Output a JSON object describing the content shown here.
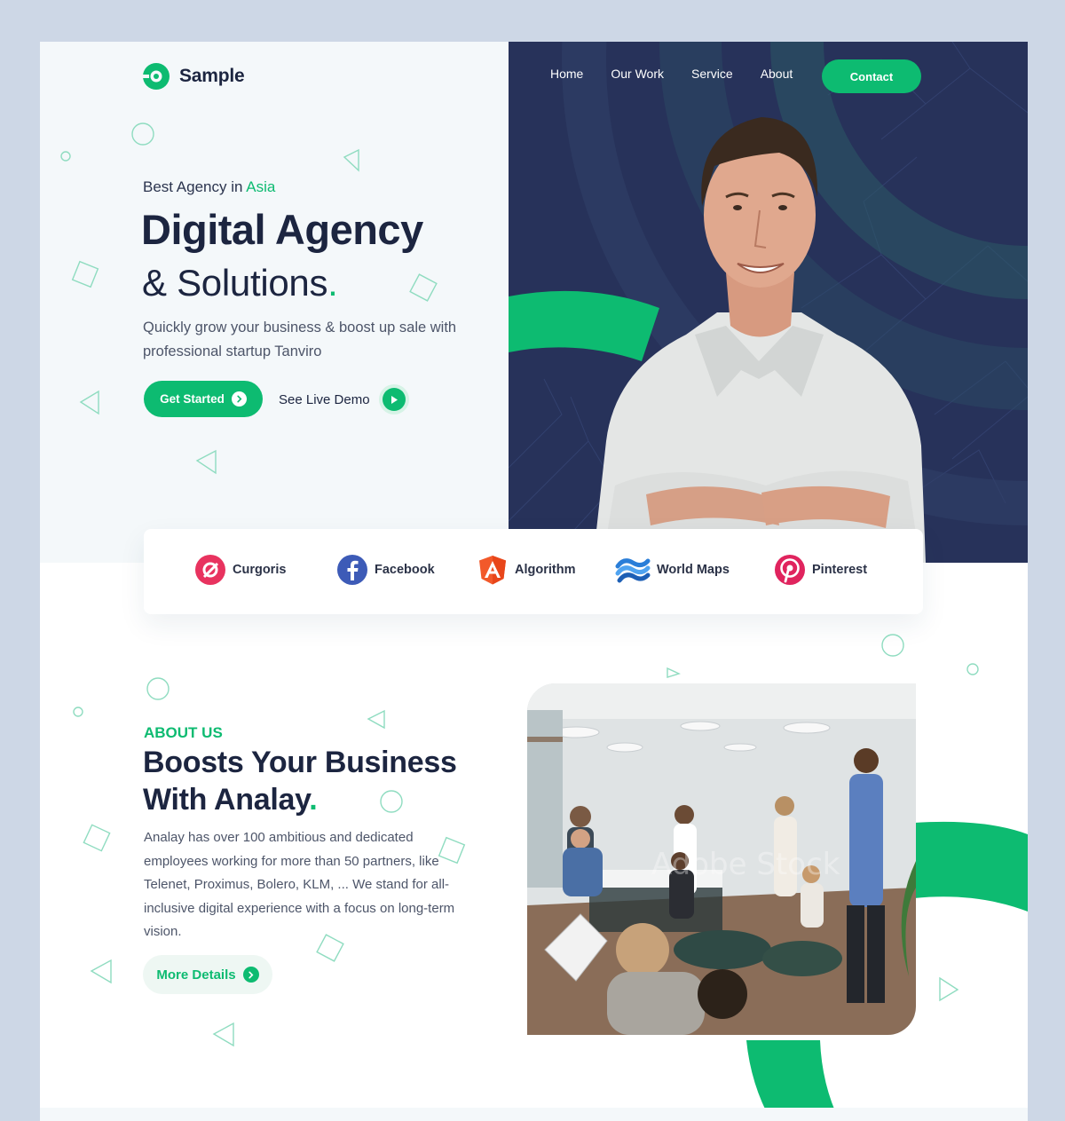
{
  "brand": {
    "name": "Sample",
    "accent_color": "#0dbb71",
    "dark_color": "#1c2540",
    "hero_panel_color": "#27325a"
  },
  "nav": {
    "links": [
      "Home",
      "Our Work",
      "Service",
      "About"
    ],
    "contact_label": "Contact"
  },
  "hero": {
    "eyebrow_prefix": "Best Agency in ",
    "eyebrow_accent": "Asia",
    "title": "Digital Agency",
    "subtitle": "& Solutions",
    "subtitle_dot": ".",
    "description": "Quickly grow your business & boost up sale with professional startup Tanviro",
    "primary_button": "Get Started",
    "secondary_button": "See Live Demo",
    "image_icon": "smiling-man-photo"
  },
  "partners": [
    {
      "name": "Curgoris",
      "icon": "curgoris-icon",
      "color": "#e8335f"
    },
    {
      "name": "Facebook",
      "icon": "facebook-icon",
      "color": "#3d5bb7"
    },
    {
      "name": "Algorithm",
      "icon": "angular-icon",
      "color": "#f2592a"
    },
    {
      "name": "World Maps",
      "icon": "world-maps-icon",
      "color": "#2a7ed8"
    },
    {
      "name": "Pinterest",
      "icon": "pinterest-icon",
      "color": "#e0245e"
    }
  ],
  "about": {
    "eyebrow": "ABOUT US",
    "title_line1": "Boosts Your Business",
    "title_line2": "With Analay",
    "title_dot": ".",
    "description": "Analay has over 100 ambitious and dedicated employees working for more than 50 partners, like Telenet, Proximus, Bolero, KLM, ... We stand for all-inclusive digital experience with a focus on long-term vision.",
    "button_label": "More Details",
    "image_icon": "team-meeting-photo",
    "watermark": "Adobe Stock"
  }
}
